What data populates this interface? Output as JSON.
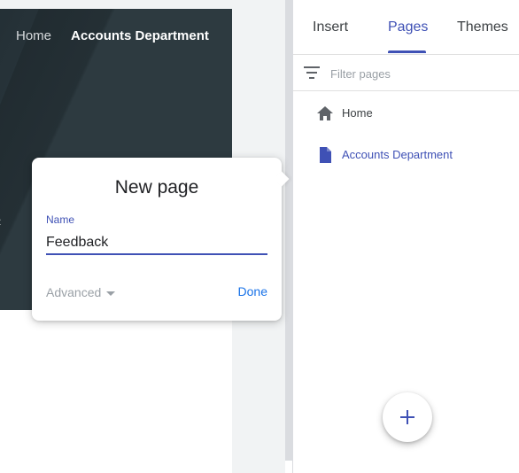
{
  "site_header": {
    "nav": [
      {
        "label": "Home",
        "active": false
      },
      {
        "label": "Accounts Department",
        "active": true
      }
    ],
    "banner_color": "#37474f"
  },
  "new_page_dialog": {
    "title": "New page",
    "name_label": "Name",
    "name_value": "Feedback",
    "advanced_label": "Advanced",
    "done_label": "Done"
  },
  "panel": {
    "tabs": [
      {
        "label": "Insert",
        "active": false
      },
      {
        "label": "Pages",
        "active": true
      },
      {
        "label": "Themes",
        "active": false
      }
    ],
    "filter": {
      "placeholder": "Filter pages",
      "icon": "filter-icon"
    },
    "pages": [
      {
        "label": "Home",
        "icon": "home-icon",
        "current": false
      },
      {
        "label": "Accounts Department",
        "icon": "page-icon",
        "current": true
      }
    ],
    "add_button_icon": "plus-icon"
  },
  "colors": {
    "accent": "#3f51b5",
    "done_blue": "#1a73e8",
    "muted": "#9aa0a6"
  }
}
